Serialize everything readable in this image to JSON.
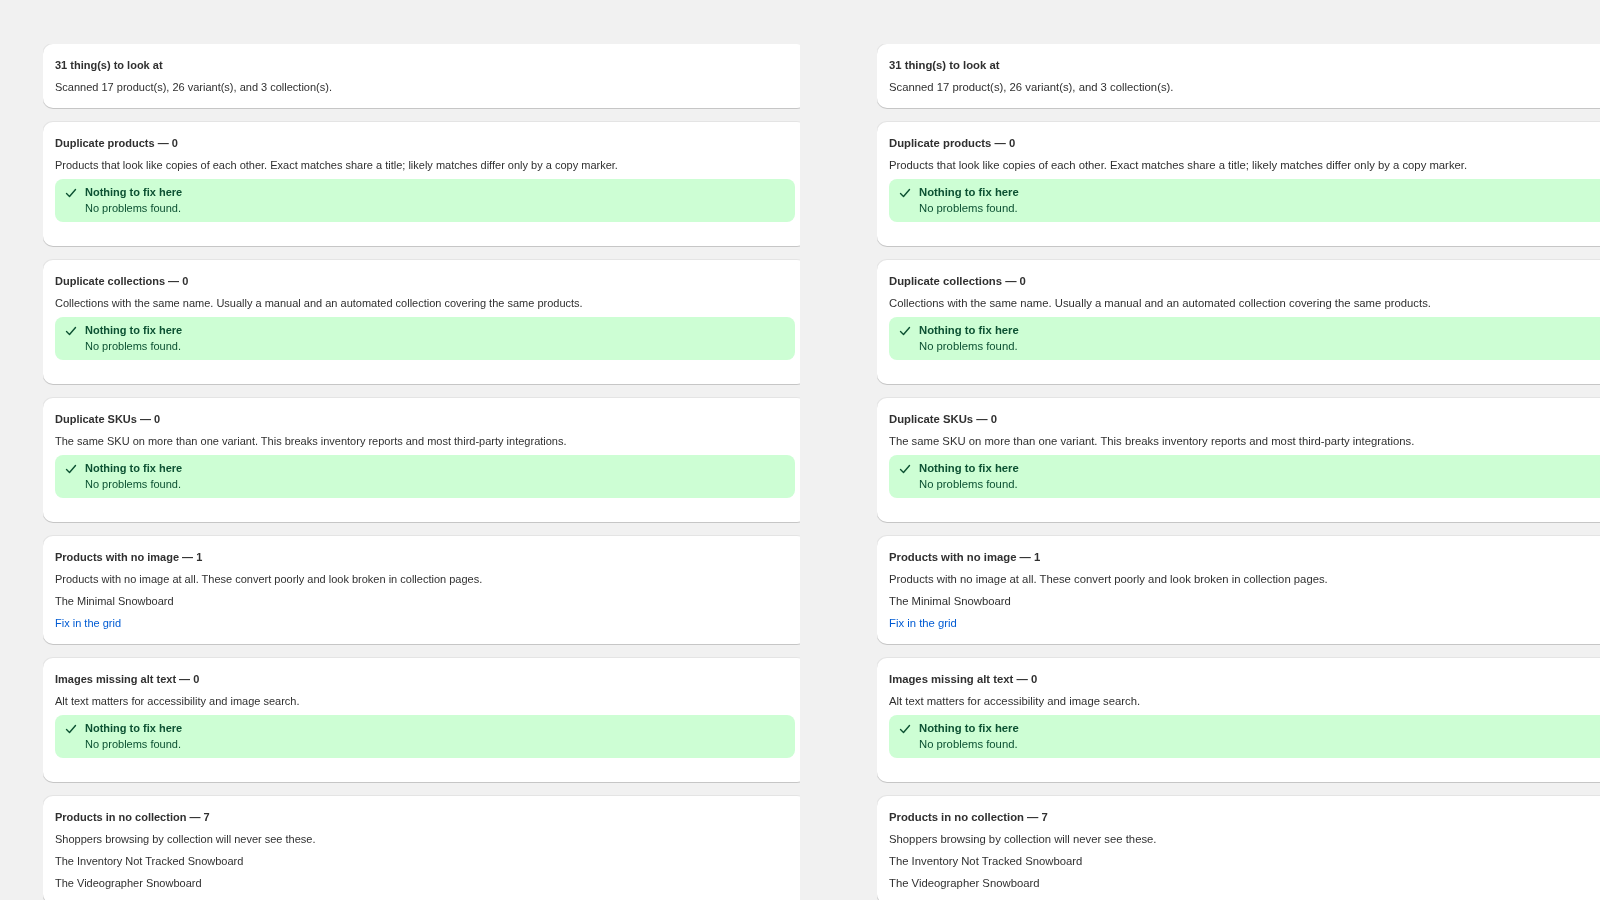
{
  "panels": [
    {
      "cards": [
        {
          "kind": "summary",
          "title": "31 thing(s) to look at",
          "text": "Scanned 17 product(s), 26 variant(s), and 3 collection(s)."
        },
        {
          "kind": "check",
          "title": "Duplicate products — 0",
          "description": "Products that look like copies of each other. Exact matches share a title; likely matches differ only by a copy marker.",
          "result": {
            "title": "Nothing to fix here",
            "text": "No problems found."
          }
        },
        {
          "kind": "check",
          "title": "Duplicate collections — 0",
          "description": "Collections with the same name. Usually a manual and an automated collection covering the same products.",
          "result": {
            "title": "Nothing to fix here",
            "text": "No problems found."
          }
        },
        {
          "kind": "check",
          "title": "Duplicate SKUs — 0",
          "description": "The same SKU on more than one variant. This breaks inventory reports and most third-party integrations.",
          "result": {
            "title": "Nothing to fix here",
            "text": "No problems found."
          }
        },
        {
          "kind": "check",
          "title": "Products with no image — 1",
          "description": "Products with no image at all. These convert poorly and look broken in collection pages.",
          "items": [
            "The Minimal Snowboard"
          ],
          "link": "Fix in the grid"
        },
        {
          "kind": "check",
          "title": "Images missing alt text — 0",
          "description": "Alt text matters for accessibility and image search.",
          "result": {
            "title": "Nothing to fix here",
            "text": "No problems found."
          }
        },
        {
          "kind": "check",
          "title": "Products in no collection — 7",
          "description": "Shoppers browsing by collection will never see these.",
          "items": [
            "The Inventory Not Tracked Snowboard",
            "The Videographer Snowboard"
          ]
        }
      ]
    },
    {
      "cards": [
        {
          "kind": "summary",
          "title": "31 thing(s) to look at",
          "text": "Scanned 17 product(s), 26 variant(s), and 3 collection(s)."
        },
        {
          "kind": "check",
          "title": "Duplicate products — 0",
          "description": "Products that look like copies of each other. Exact matches share a title; likely matches differ only by a copy marker.",
          "result": {
            "title": "Nothing to fix here",
            "text": "No problems found."
          }
        },
        {
          "kind": "check",
          "title": "Duplicate collections — 0",
          "description": "Collections with the same name. Usually a manual and an automated collection covering the same products.",
          "result": {
            "title": "Nothing to fix here",
            "text": "No problems found."
          }
        },
        {
          "kind": "check",
          "title": "Duplicate SKUs — 0",
          "description": "The same SKU on more than one variant. This breaks inventory reports and most third-party integrations.",
          "result": {
            "title": "Nothing to fix here",
            "text": "No problems found."
          }
        },
        {
          "kind": "check",
          "title": "Products with no image — 1",
          "description": "Products with no image at all. These convert poorly and look broken in collection pages.",
          "items": [
            "The Minimal Snowboard"
          ],
          "link": "Fix in the grid"
        },
        {
          "kind": "check",
          "title": "Images missing alt text — 0",
          "description": "Alt text matters for accessibility and image search.",
          "result": {
            "title": "Nothing to fix here",
            "text": "No problems found."
          }
        },
        {
          "kind": "check",
          "title": "Products in no collection — 7",
          "description": "Shoppers browsing by collection will never see these.",
          "items": [
            "The Inventory Not Tracked Snowboard",
            "The Videographer Snowboard"
          ]
        }
      ]
    }
  ]
}
